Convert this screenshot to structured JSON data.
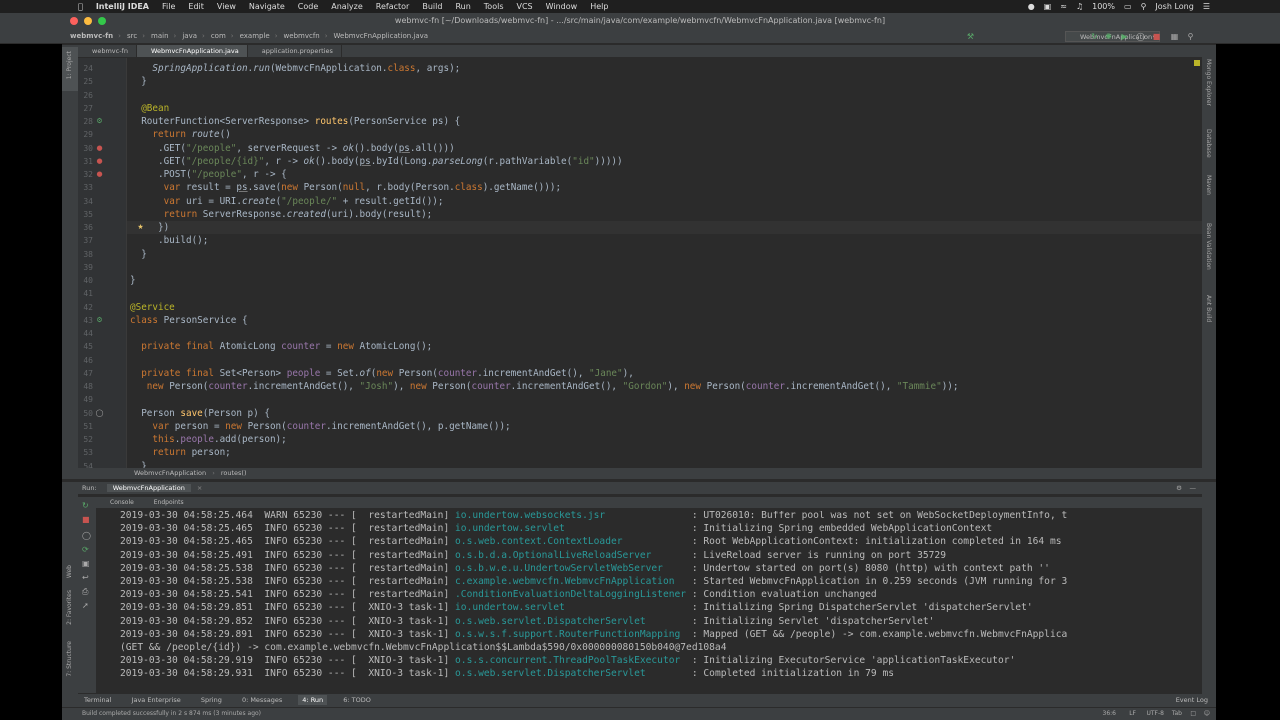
{
  "menubar": {
    "app": "IntelliJ IDEA",
    "items": [
      "File",
      "Edit",
      "View",
      "Navigate",
      "Code",
      "Analyze",
      "Refactor",
      "Build",
      "Run",
      "Tools",
      "VCS",
      "Window",
      "Help"
    ],
    "battery": "100%",
    "user": "Josh Long"
  },
  "window": {
    "title": "webmvc-fn [~/Downloads/webmvc-fn] - .../src/main/java/com/example/webmvcfn/WebmvcFnApplication.java [webmvc-fn]"
  },
  "navbar": {
    "crumbs": [
      "webmvc-fn",
      "src",
      "main",
      "java",
      "com",
      "example",
      "webmvcfn",
      "WebmvcFnApplication.java"
    ],
    "run_config": "WebmvcFnApplication"
  },
  "tabs": [
    "webmvc-fn",
    "WebmvcFnApplication.java",
    "application.properties"
  ],
  "left_tools": [
    "1: Project",
    "7: Structure",
    "2: Favorites",
    "Web"
  ],
  "right_tools": [
    "Mongo Explorer",
    "Database",
    "Maven",
    "Bean Validation",
    "Ant Build"
  ],
  "editor": {
    "lines": [
      {
        "n": "24",
        "html": "    <span class=\"it\">SpringApplication</span>.<span class=\"it\">run</span>(WebmvcFnApplication.<span class=\"kw\">class</span>, args);"
      },
      {
        "n": "25",
        "html": "  }"
      },
      {
        "n": "26",
        "html": ""
      },
      {
        "n": "27",
        "html": "  <span class=\"ann\">@Bean</span>"
      },
      {
        "n": "28",
        "html": "  RouterFunction&lt;ServerResponse&gt; <span style=\"color:#ffc66d\">routes</span>(PersonService ps) {"
      },
      {
        "n": "29",
        "html": "    <span class=\"kw\">return</span> <span class=\"it\">route</span>()"
      },
      {
        "n": "30",
        "html": "     .GET(<span class=\"str\">\"/people\"</span>, serverRequest -&gt; <span class=\"it\">ok</span>().body(<span class=\"ul\">ps</span>.all()))"
      },
      {
        "n": "31",
        "html": "     .GET(<span class=\"str\">\"/people/{id}\"</span>, r -&gt; <span class=\"it\">ok</span>().body(<span class=\"ul\">ps</span>.byId(Long.<span class=\"it\">parseLong</span>(r.pathVariable(<span class=\"str\">\"id\"</span>)))))"
      },
      {
        "n": "32",
        "html": "     .POST(<span class=\"str\">\"/people\"</span>, r -&gt; {"
      },
      {
        "n": "33",
        "html": "      <span class=\"kw\">var</span> result = <span class=\"ul\">ps</span>.save(<span class=\"kw\">new</span> Person(<span class=\"kw\">null</span>, r.body(Person.<span class=\"kw\">class</span>).getName()));"
      },
      {
        "n": "34",
        "html": "      <span class=\"kw\">var</span> uri = URI.<span class=\"it\">create</span>(<span class=\"str\">\"/people/\"</span> + result.getId());"
      },
      {
        "n": "35",
        "html": "      <span class=\"kw\">return</span> ServerResponse.<span class=\"it\">created</span>(uri).body(result);"
      },
      {
        "n": "36",
        "html": "     })"
      },
      {
        "n": "37",
        "html": "     .build();"
      },
      {
        "n": "38",
        "html": "  }"
      },
      {
        "n": "39",
        "html": ""
      },
      {
        "n": "40",
        "html": "}"
      },
      {
        "n": "41",
        "html": ""
      },
      {
        "n": "42",
        "html": "<span class=\"ann\">@Service</span>"
      },
      {
        "n": "43",
        "html": "<span class=\"kw\">class</span> PersonService {"
      },
      {
        "n": "44",
        "html": ""
      },
      {
        "n": "45",
        "html": "  <span class=\"kw\">private final</span> AtomicLong <span class=\"fld\">counter</span> = <span class=\"kw\">new</span> AtomicLong();"
      },
      {
        "n": "46",
        "html": ""
      },
      {
        "n": "47",
        "html": "  <span class=\"kw\">private final</span> Set&lt;Person&gt; <span class=\"fld\">people</span> = Set.<span class=\"it\">of</span>(<span class=\"kw\">new</span> Person(<span class=\"fld\">counter</span>.incrementAndGet(), <span class=\"str\">\"Jane\"</span>),"
      },
      {
        "n": "48",
        "html": "   <span class=\"kw\">new</span> Person(<span class=\"fld\">counter</span>.incrementAndGet(), <span class=\"str\">\"Josh\"</span>), <span class=\"kw\">new</span> Person(<span class=\"fld\">counter</span>.incrementAndGet(), <span class=\"str\">\"Gordon\"</span>), <span class=\"kw\">new</span> Person(<span class=\"fld\">counter</span>.incrementAndGet(), <span class=\"str\">\"Tammie\"</span>));"
      },
      {
        "n": "49",
        "html": ""
      },
      {
        "n": "50",
        "html": "  Person <span style=\"color:#ffc66d\">save</span>(Person p) {"
      },
      {
        "n": "51",
        "html": "    <span class=\"kw\">var</span> person = <span class=\"kw\">new</span> Person(<span class=\"fld\">counter</span>.incrementAndGet(), p.getName());"
      },
      {
        "n": "52",
        "html": "    <span class=\"kw\">this</span>.<span class=\"fld\">people</span>.add(person);"
      },
      {
        "n": "53",
        "html": "    <span class=\"kw\">return</span> person;"
      },
      {
        "n": "54",
        "html": "  }"
      }
    ]
  },
  "breadcrumb": [
    "WebmvcFnApplication",
    "routes()"
  ],
  "run_panel": {
    "label": "Run:",
    "config": "WebmvcFnApplication",
    "tabs": [
      "Console",
      "Endpoints"
    ]
  },
  "console": {
    "lines": [
      {
        "t": "2019-03-30 04:58:25.464",
        "lvl": "WARN",
        "pid": "65230",
        "thr": "restartedMain",
        "cls": "io.undertow.websockets.jsr",
        "msg": "UT026010: Buffer pool was not set on WebSocketDeploymentInfo, t"
      },
      {
        "t": "2019-03-30 04:58:25.465",
        "lvl": "INFO",
        "pid": "65230",
        "thr": "restartedMain",
        "cls": "io.undertow.servlet",
        "msg": "Initializing Spring embedded WebApplicationContext"
      },
      {
        "t": "2019-03-30 04:58:25.465",
        "lvl": "INFO",
        "pid": "65230",
        "thr": "restartedMain",
        "cls": "o.s.web.context.ContextLoader",
        "msg": "Root WebApplicationContext: initialization completed in 164 ms"
      },
      {
        "t": "2019-03-30 04:58:25.491",
        "lvl": "INFO",
        "pid": "65230",
        "thr": "restartedMain",
        "cls": "o.s.b.d.a.OptionalLiveReloadServer",
        "msg": "LiveReload server is running on port 35729"
      },
      {
        "t": "2019-03-30 04:58:25.538",
        "lvl": "INFO",
        "pid": "65230",
        "thr": "restartedMain",
        "cls": "o.s.b.w.e.u.UndertowServletWebServer",
        "msg": "Undertow started on port(s) 8080 (http) with context path ''"
      },
      {
        "t": "2019-03-30 04:58:25.538",
        "lvl": "INFO",
        "pid": "65230",
        "thr": "restartedMain",
        "cls": "c.example.webmvcfn.WebmvcFnApplication",
        "msg": "Started WebmvcFnApplication in 0.259 seconds (JVM running for 3"
      },
      {
        "t": "2019-03-30 04:58:25.541",
        "lvl": "INFO",
        "pid": "65230",
        "thr": "restartedMain",
        "cls": ".ConditionEvaluationDeltaLoggingListener",
        "msg": "Condition evaluation unchanged"
      },
      {
        "t": "2019-03-30 04:58:29.851",
        "lvl": "INFO",
        "pid": "65230",
        "thr": "XNIO-3 task-1",
        "cls": "io.undertow.servlet",
        "msg": "Initializing Spring DispatcherServlet 'dispatcherServlet'"
      },
      {
        "t": "2019-03-30 04:58:29.852",
        "lvl": "INFO",
        "pid": "65230",
        "thr": "XNIO-3 task-1",
        "cls": "o.s.web.servlet.DispatcherServlet",
        "msg": "Initializing Servlet 'dispatcherServlet'"
      },
      {
        "t": "2019-03-30 04:58:29.891",
        "lvl": "INFO",
        "pid": "65230",
        "thr": "XNIO-3 task-1",
        "cls": "o.s.w.s.f.support.RouterFunctionMapping",
        "msg": "Mapped (GET && /people) -> com.example.webmvcfn.WebmvcFnApplica"
      },
      {
        "raw": "(GET && /people/{id}) -> com.example.webmvcfn.WebmvcFnApplication$$Lambda$590/0x000000080150b040@7ed108a4"
      },
      {
        "t": "2019-03-30 04:58:29.919",
        "lvl": "INFO",
        "pid": "65230",
        "thr": "XNIO-3 task-1",
        "cls": "o.s.s.concurrent.ThreadPoolTaskExecutor",
        "msg": "Initializing ExecutorService 'applicationTaskExecutor'"
      },
      {
        "t": "2019-03-30 04:58:29.931",
        "lvl": "INFO",
        "pid": "65230",
        "thr": "XNIO-3 task-1",
        "cls": "o.s.web.servlet.DispatcherServlet",
        "msg": "Completed initialization in 79 ms"
      }
    ]
  },
  "bottom_tools": [
    "Terminal",
    "Java Enterprise",
    "Spring",
    "0: Messages",
    "4: Run",
    "6: TODO"
  ],
  "event_log": "Event Log",
  "status": {
    "message": "Build completed successfully in 2 s 874 ms (3 minutes ago)",
    "position": "36:6",
    "line_sep": "LF",
    "encoding": "UTF-8",
    "indent": "Tab"
  },
  "colors": {
    "keyword": "#cc7832",
    "string": "#6a8759",
    "annotation": "#bbb529",
    "field": "#9876aa",
    "log_class": "#299999"
  }
}
